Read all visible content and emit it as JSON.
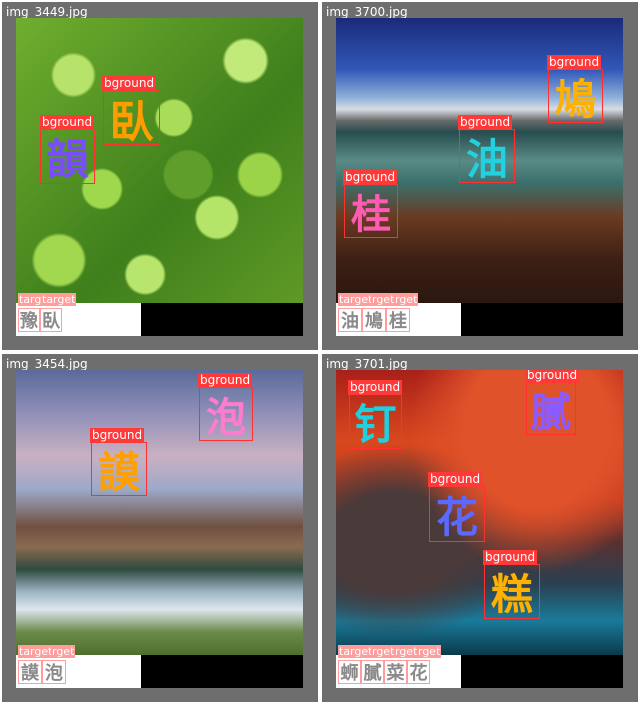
{
  "panels": [
    {
      "filename": "img_3449.jpg",
      "detections": [
        {
          "label": "bground",
          "glyph": "臥",
          "color": "#ff9d00"
        },
        {
          "label": "bground",
          "glyph": "韻",
          "color": "#7a4bff"
        }
      ],
      "targets": [
        {
          "label": "targ",
          "glyph": "豫"
        },
        {
          "label": "target",
          "glyph": "臥"
        }
      ]
    },
    {
      "filename": "img_3700.jpg",
      "detections": [
        {
          "label": "bground",
          "glyph": "鳩",
          "color": "#ffb000"
        },
        {
          "label": "bground",
          "glyph": "油",
          "color": "#22d0e0"
        },
        {
          "label": "bground",
          "glyph": "桂",
          "color": "#ff5bb5"
        }
      ],
      "targets": [
        {
          "label": "target",
          "glyph": "油"
        },
        {
          "label": "rget",
          "glyph": "鳩"
        },
        {
          "label": "rget",
          "glyph": "桂"
        }
      ]
    },
    {
      "filename": "img_3454.jpg",
      "detections": [
        {
          "label": "bground",
          "glyph": "泡",
          "color": "#ff7bd0"
        },
        {
          "label": "bground",
          "glyph": "謨",
          "color": "#ffa000"
        }
      ],
      "targets": [
        {
          "label": "target",
          "glyph": "謨"
        },
        {
          "label": "rget",
          "glyph": "泡"
        }
      ]
    },
    {
      "filename": "img_3701.jpg",
      "detections": [
        {
          "label": "bground",
          "glyph": "钉",
          "color": "#1fd0e0"
        },
        {
          "label": "bground",
          "glyph": "膩",
          "color": "#8a5cff"
        },
        {
          "label": "bground",
          "glyph": "花",
          "color": "#5a6aff"
        },
        {
          "label": "bground",
          "glyph": "糕",
          "color": "#ffb000"
        }
      ],
      "targets": [
        {
          "label": "target",
          "glyph": "蛳"
        },
        {
          "label": "rget",
          "glyph": "膩"
        },
        {
          "label": "rget",
          "glyph": "菜"
        },
        {
          "label": "rget",
          "glyph": "花"
        }
      ]
    }
  ]
}
